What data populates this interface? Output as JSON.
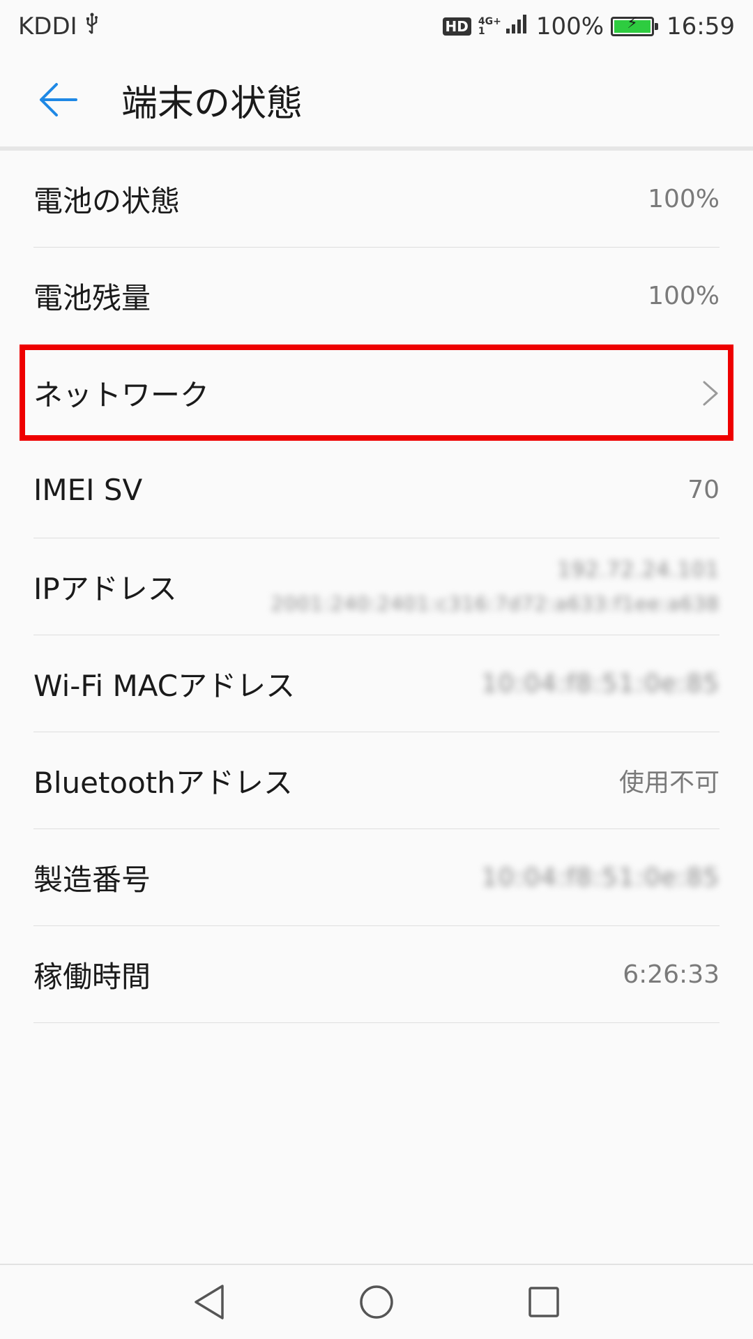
{
  "status_bar": {
    "carrier": "KDDI",
    "hd_label": "HD",
    "network_type": "4G+",
    "network_sub": "1",
    "battery_percent": "100%",
    "battery_level": 1.0,
    "time": "16:59"
  },
  "app_bar": {
    "title": "端末の状態"
  },
  "rows": [
    {
      "label": "電池の状態",
      "value": "100%"
    },
    {
      "label": "電池残量",
      "value": "100%"
    },
    {
      "label": "ネットワーク",
      "value": ""
    },
    {
      "label": "IMEI SV",
      "value": "70"
    },
    {
      "label": "IPアドレス",
      "value_v4": "192.72.24.101",
      "value_v6": "2001:240:2401:c316:7d72:a633:f1ee:a638"
    },
    {
      "label": "Wi-Fi MACアドレス",
      "value": "10:04:f8:51:0e:85"
    },
    {
      "label": "Bluetoothアドレス",
      "value": "使用不可"
    },
    {
      "label": "製造番号",
      "value": "10:04:f8:51:0e:85"
    },
    {
      "label": "稼働時間",
      "value": "6:26:33"
    }
  ],
  "colors": {
    "accent": "#1e88e5",
    "highlight": "#ee0000",
    "battery_fill": "#2ecc40"
  },
  "icons": {
    "back": "arrow-left-icon",
    "chevron": "chevron-right-icon",
    "nav_back": "triangle-back-icon",
    "nav_home": "circle-home-icon",
    "nav_recents": "square-recents-icon"
  }
}
